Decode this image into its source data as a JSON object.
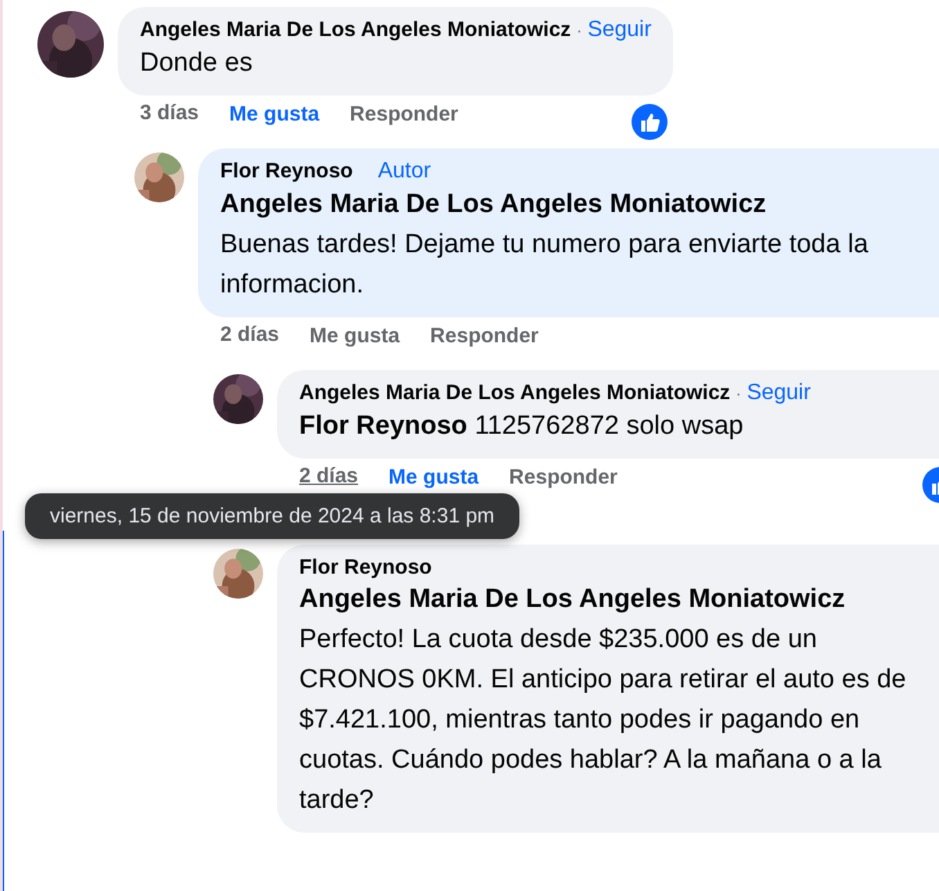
{
  "comments": [
    {
      "author": "Angeles Maria De Los Angeles Moniatowicz",
      "separator": "·",
      "follow": "Seguir",
      "text": "Donde es",
      "time": "3 días",
      "hovered": false,
      "like": "Me gusta",
      "liked": true,
      "reply": "Responder",
      "reacted": true,
      "highlighted": false,
      "children": [
        {
          "author": "Flor Reynoso",
          "badge": "Autor",
          "mention": {
            "name": "Angeles Maria De Los Angeles Moniatowicz",
            "kind": "block"
          },
          "text": "Buenas tardes! Dejame tu numero para enviarte toda la informacion.",
          "time": "2 días",
          "hovered": false,
          "like": "Me gusta",
          "liked": false,
          "reply": "Responder",
          "reacted": false,
          "highlighted": false,
          "children": [
            {
              "author": "Angeles Maria De Los Angeles Moniatowicz",
              "separator": "·",
              "follow": "Seguir",
              "mention": {
                "name": "Flor Reynoso",
                "kind": "inline"
              },
              "text": "1125762872 solo wsap",
              "time": "2 días",
              "hovered": true,
              "tooltip": "viernes, 15 de noviembre de 2024 a las 8:31 pm",
              "like": "Me gusta",
              "liked": true,
              "reply": "Responder",
              "reacted": true,
              "highlighted": false
            },
            {
              "author": "Flor Reynoso",
              "mention": {
                "name": "Angeles Maria De Los Angeles Moniatowicz",
                "kind": "block"
              },
              "text": "Perfecto! La cuota desde $235.000 es de un CRONOS 0KM. El anticipo para retirar el auto es de $7.421.100, mientras tanto podes ir pagando en cuotas. Cuándo podes hablar? A la mañana o a la tarde?",
              "highlighted": true
            }
          ]
        }
      ]
    }
  ]
}
